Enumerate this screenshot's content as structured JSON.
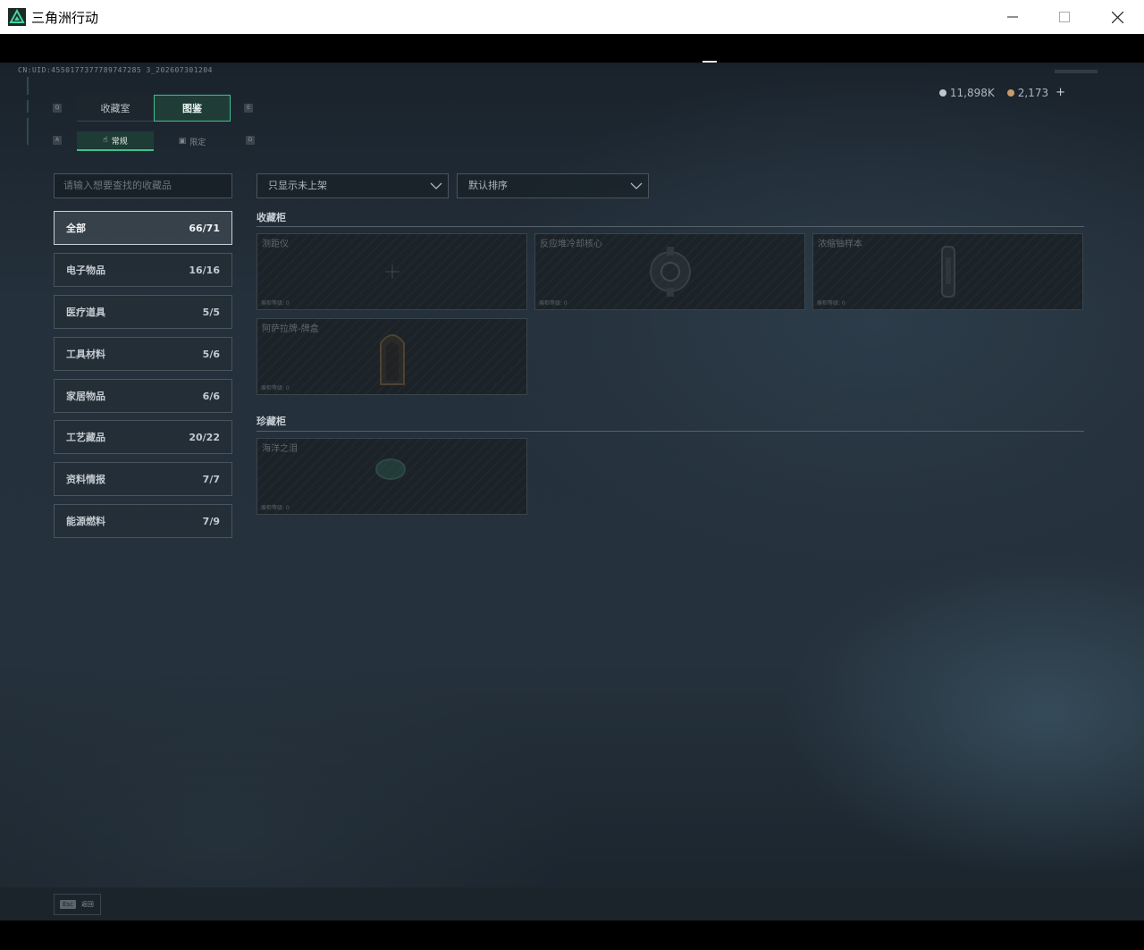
{
  "window": {
    "title": "三角洲行动",
    "logo_icon": "delta-force-logo-icon",
    "controls": [
      "minimize-icon",
      "maximize-icon",
      "close-icon"
    ]
  },
  "header": {
    "uid": "CN:UID:4550177377789747285 3_202607301204",
    "currency": [
      {
        "icon": "silver-coin-icon",
        "value": "11,898K",
        "color": "#c0c6cc"
      },
      {
        "icon": "bronze-coin-icon",
        "value": "2,173",
        "color": "#c99a6a"
      }
    ],
    "plus_label": "+"
  },
  "tabs": {
    "primary": [
      {
        "key": "Q",
        "label": "收藏室",
        "active": false
      },
      {
        "key": "E",
        "label": "图鉴",
        "active": true
      }
    ],
    "secondary": [
      {
        "key": "A",
        "label": "常规",
        "icon": "hand-icon",
        "active": true
      },
      {
        "key": "D",
        "label": "限定",
        "icon": "badge-icon",
        "active": false
      }
    ]
  },
  "search": {
    "placeholder": "请输入想要查找的收藏品"
  },
  "categories": [
    {
      "label": "全部",
      "count": "66/71",
      "active": true
    },
    {
      "label": "电子物品",
      "count": "16/16",
      "active": false
    },
    {
      "label": "医疗道具",
      "count": "5/5",
      "active": false
    },
    {
      "label": "工具材料",
      "count": "5/6",
      "active": false
    },
    {
      "label": "家居物品",
      "count": "6/6",
      "active": false
    },
    {
      "label": "工艺藏品",
      "count": "20/22",
      "active": false
    },
    {
      "label": "资料情报",
      "count": "7/7",
      "active": false
    },
    {
      "label": "能源燃料",
      "count": "7/9",
      "active": false
    }
  ],
  "filters": {
    "display": "只显示未上架",
    "sort": "默认排序"
  },
  "sections": [
    {
      "title": "收藏柜",
      "items": [
        {
          "name": "测距仪",
          "level": "展柜等级: 0",
          "icon": "rangefinder-icon"
        },
        {
          "name": "反应堆冷却核心",
          "level": "展柜等级: 0",
          "icon": "reactor-core-icon"
        },
        {
          "name": "浓缩铀样本",
          "level": "展柜等级: 0",
          "icon": "uranium-sample-icon"
        },
        {
          "name": "阿萨拉牌-牌盒",
          "level": "展柜等级: 0",
          "icon": "card-box-icon"
        }
      ]
    },
    {
      "title": "珍藏柜",
      "items": [
        {
          "name": "海洋之泪",
          "level": "展柜等级: 0",
          "icon": "ocean-tear-gem-icon"
        }
      ]
    }
  ],
  "footer": {
    "key": "Esc",
    "label": "返回"
  }
}
